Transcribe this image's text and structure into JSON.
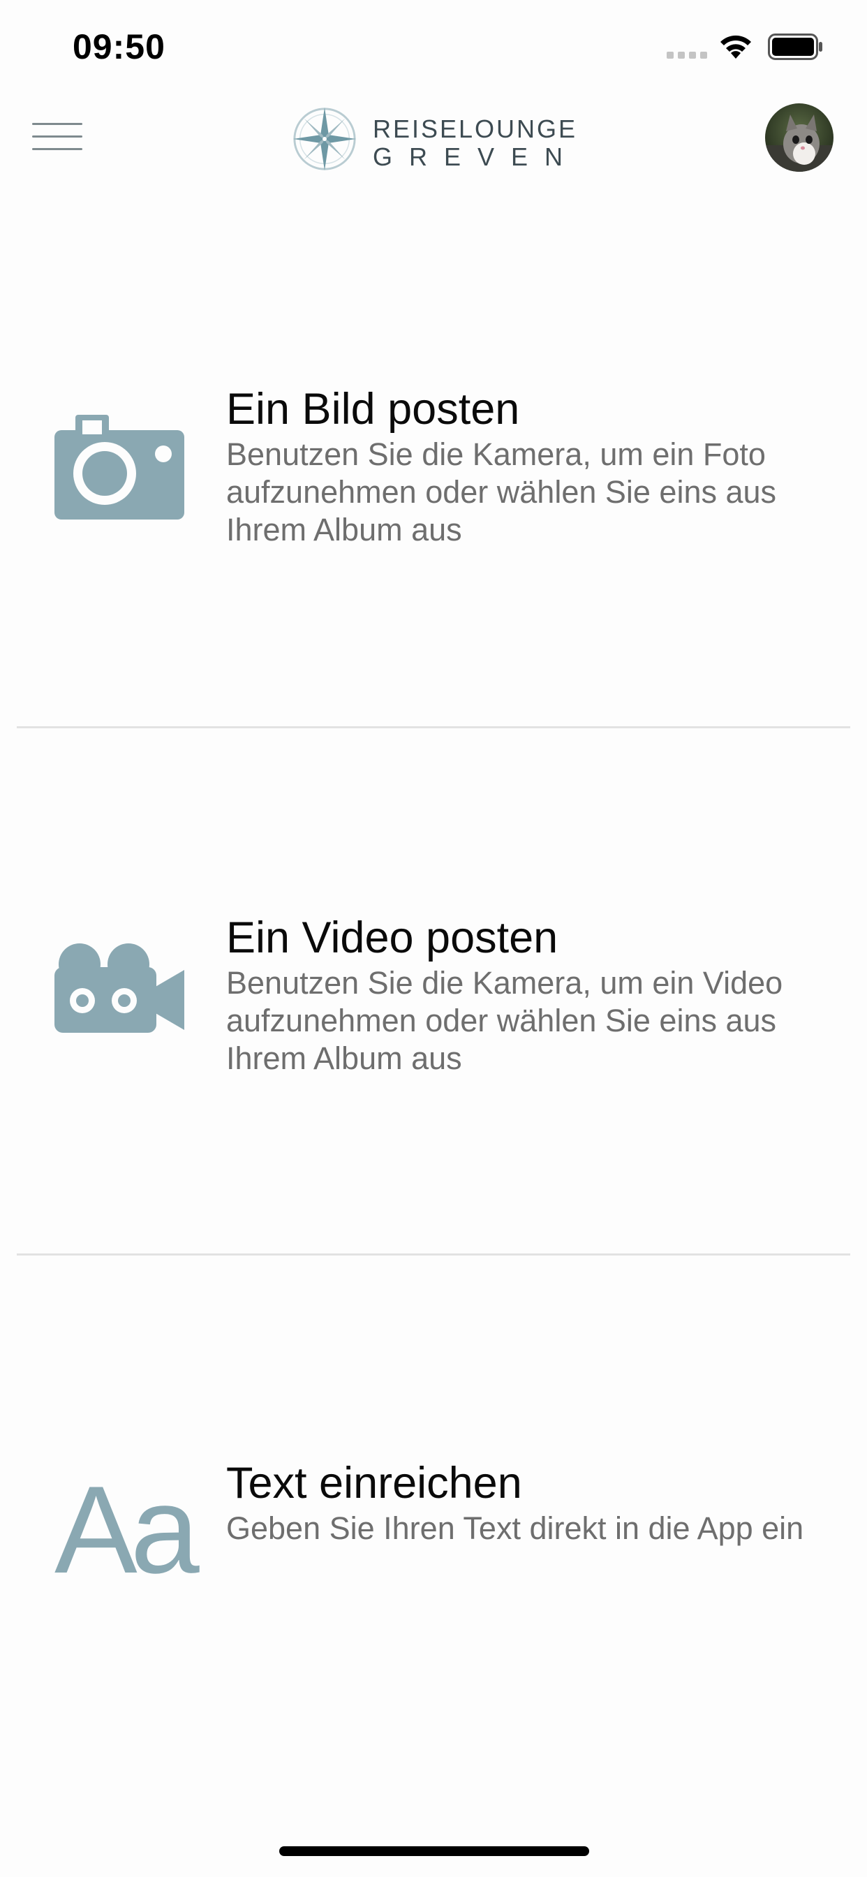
{
  "status_bar": {
    "time": "09:50"
  },
  "nav": {
    "logo_line1": "REISELOUNGE",
    "logo_line2": "GREVEN"
  },
  "colors": {
    "icon_accent": "#8aa8b2",
    "title": "#0a0a0a",
    "description": "#6e6e6e",
    "divider": "#e2e2e2"
  },
  "options": [
    {
      "icon": "camera-icon",
      "title": "Ein Bild posten",
      "description": "Benutzen Sie die Kamera, um ein Foto aufzunehmen oder wählen Sie eins aus Ihrem Album aus"
    },
    {
      "icon": "video-camera-icon",
      "title": "Ein Video posten",
      "description": "Benutzen Sie die Kamera, um ein Video aufzunehmen oder wählen Sie eins aus Ihrem Album aus"
    },
    {
      "icon": "text-icon",
      "icon_text": "Aa",
      "title": "Text einreichen",
      "description": "Geben Sie Ihren Text direkt in die App ein"
    }
  ]
}
